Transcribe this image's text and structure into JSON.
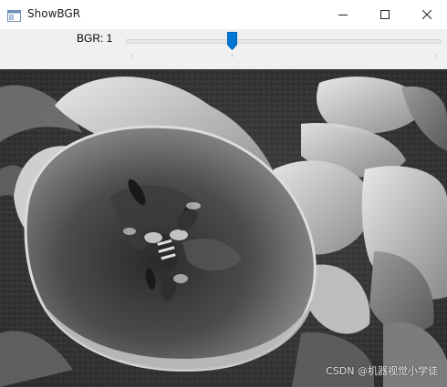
{
  "window": {
    "title": "ShowBGR",
    "icon": "opencv-window-icon"
  },
  "trackbar": {
    "label": "BGR: 1",
    "value": 1,
    "min": 0,
    "max": 2
  },
  "image": {
    "description_icon": "grayscale-flower-photo",
    "watermark": "CSDN @机器视觉小学徒"
  },
  "colors": {
    "thumb": "#0078d7",
    "panel": "#f0f0f0"
  }
}
